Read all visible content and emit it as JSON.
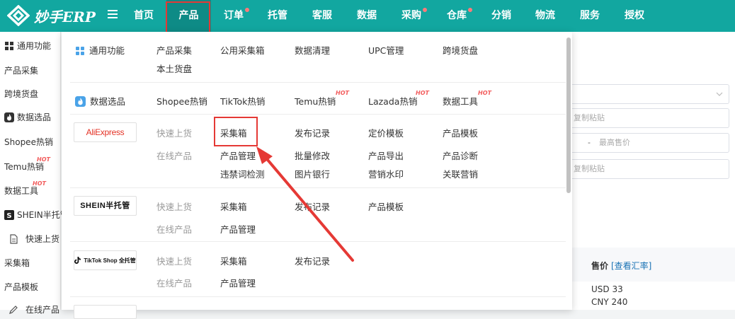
{
  "app": {
    "logo_text": "妙手ERP"
  },
  "nav": {
    "items": [
      {
        "label": "首页"
      },
      {
        "label": "产品"
      },
      {
        "label": "订单"
      },
      {
        "label": "托管"
      },
      {
        "label": "客服"
      },
      {
        "label": "数据"
      },
      {
        "label": "采购"
      },
      {
        "label": "仓库"
      },
      {
        "label": "分销"
      },
      {
        "label": "物流"
      },
      {
        "label": "服务"
      },
      {
        "label": "授权"
      }
    ]
  },
  "left_sidebar": {
    "items": [
      {
        "label": "通用功能"
      },
      {
        "label": "产品采集"
      },
      {
        "label": "跨境货盘"
      },
      {
        "label": "数据选品"
      },
      {
        "label": "Shopee热销"
      },
      {
        "label": "Temu热销"
      },
      {
        "label": "数据工具"
      },
      {
        "label": "SHEIN半托管"
      },
      {
        "label": "快速上货"
      },
      {
        "label": "采集箱"
      },
      {
        "label": "产品模板"
      },
      {
        "label": "在线产品"
      }
    ],
    "hot_badge": "HOT"
  },
  "dropdown": {
    "hot_badge": "HOT",
    "general": {
      "title": "通用功能",
      "links": [
        "产品采集",
        "公用采集箱",
        "数据清理",
        "UPC管理",
        "跨境货盘",
        "本土货盘"
      ]
    },
    "data_selection": {
      "title": "数据选品",
      "links": [
        "Shopee热销",
        "TikTok热销",
        "Temu热销",
        "Lazada热销",
        "数据工具"
      ]
    },
    "aliexpress": {
      "brand": "AliExpress",
      "quick_label": "快速上货",
      "online_label": "在线产品",
      "quick_links": [
        "采集箱",
        "发布记录",
        "定价模板",
        "产品模板"
      ],
      "online_links": [
        "产品管理",
        "批量修改",
        "产品导出",
        "产品诊断",
        "违禁词检测",
        "图片银行",
        "营销水印",
        "关联营销"
      ]
    },
    "shein": {
      "brand": "SHEIN半托管",
      "quick_label": "快速上货",
      "online_label": "在线产品",
      "quick_links": [
        "采集箱",
        "发布记录",
        "产品模板"
      ],
      "online_links": [
        "产品管理"
      ]
    },
    "tiktok": {
      "brand": "TikTok Shop 全托管",
      "quick_label": "快速上货",
      "online_label": "在线产品",
      "quick_links": [
        "采集箱",
        "发布记录"
      ],
      "online_links": [
        "产品管理"
      ]
    }
  },
  "right_panel": {
    "paste_placeholder": "复制粘贴",
    "price_max_placeholder": "最高售价",
    "price_sep": "-",
    "price_header": "售价",
    "summary_link": "[查看汇率]",
    "prices": [
      "USD 33",
      "CNY 240"
    ]
  },
  "colors": {
    "brand": "#12a7a0",
    "nav_active": "#0e8b86",
    "highlight": "#e53935",
    "hot": "#f25c5c",
    "link_blue": "#1a73b5"
  }
}
